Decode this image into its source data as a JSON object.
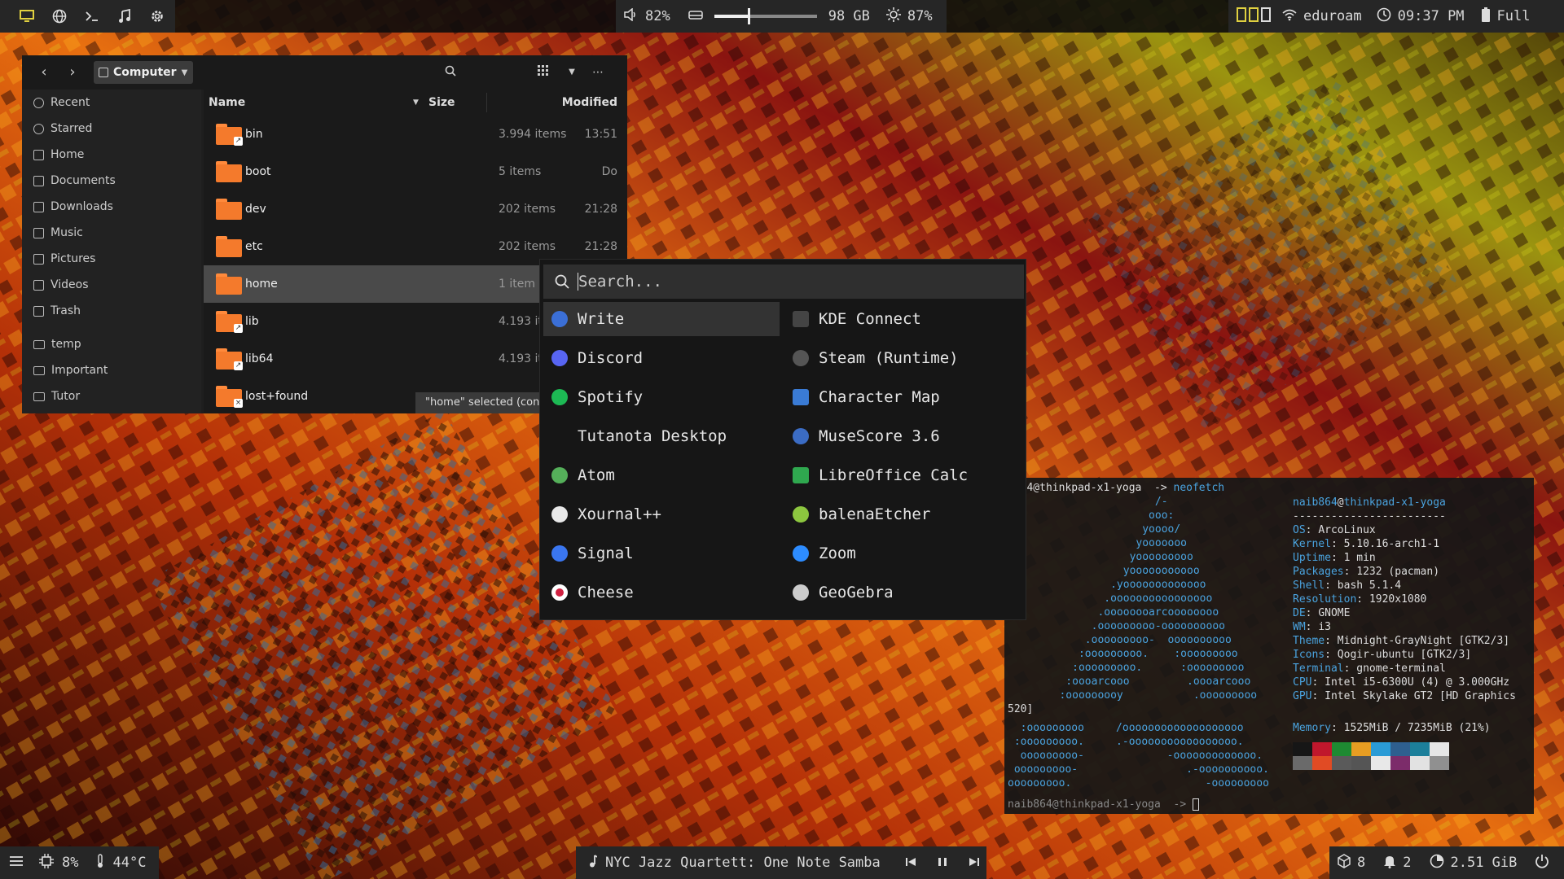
{
  "topbar": {
    "volume": "82%",
    "storage": "98 GB",
    "brightness": "87%",
    "wifi": "eduroam",
    "time": "09:37 PM",
    "battery": "Full",
    "storage_fill": 0.33
  },
  "bottombar": {
    "cpu": "8%",
    "temp": "44°C",
    "now_playing": "NYC Jazz Quartett: One Note Samba",
    "packages": "8",
    "notifications": "2",
    "memory": "2.51 GiB"
  },
  "filemanager": {
    "path": "Computer",
    "sidebar": [
      {
        "label": "Recent",
        "icon": "clock-icon"
      },
      {
        "label": "Starred",
        "icon": "star-icon"
      },
      {
        "label": "Home",
        "icon": "home-icon"
      },
      {
        "label": "Documents",
        "icon": "document-icon"
      },
      {
        "label": "Downloads",
        "icon": "download-icon"
      },
      {
        "label": "Music",
        "icon": "music-icon"
      },
      {
        "label": "Pictures",
        "icon": "picture-icon"
      },
      {
        "label": "Videos",
        "icon": "video-icon"
      },
      {
        "label": "Trash",
        "icon": "trash-icon"
      }
    ],
    "bookmarks": [
      "temp",
      "Important",
      "Tutor"
    ],
    "columns": {
      "name": "Name",
      "size": "Size",
      "modified": "Modified"
    },
    "rows": [
      {
        "name": "bin",
        "size": "3.994 items",
        "modified": "13:51"
      },
      {
        "name": "boot",
        "size": "5 items",
        "modified": "Do"
      },
      {
        "name": "dev",
        "size": "202 items",
        "modified": "21:28"
      },
      {
        "name": "etc",
        "size": "202 items",
        "modified": "21:28"
      },
      {
        "name": "home",
        "size": "1 item",
        "modified": ""
      },
      {
        "name": "lib",
        "size": "4.193 items",
        "modified": ""
      },
      {
        "name": "lib64",
        "size": "4.193 items",
        "modified": ""
      },
      {
        "name": "lost+found",
        "size": "",
        "modified": ""
      }
    ],
    "status": "\"home\" selected (con"
  },
  "launcher": {
    "placeholder": "Search...",
    "left": [
      "Write",
      "Discord",
      "Spotify",
      "Tutanota Desktop",
      "Atom",
      "Xournal++",
      "Signal",
      "Cheese"
    ],
    "right": [
      "KDE Connect",
      "Steam (Runtime)",
      "Character Map",
      "MuseScore 3.6",
      "LibreOffice Calc",
      "balenaEtcher",
      "Zoom",
      "GeoGebra"
    ],
    "icon_colors": {
      "Write": "#3b6fd6",
      "Discord": "#5865f2",
      "Spotify": "#1db954",
      "Tutanota Desktop": "transparent",
      "Atom": "#55b05a",
      "Xournal++": "#e8e8e8",
      "Signal": "#3a76f0",
      "Cheese": "#ffffff",
      "KDE Connect": "#444444",
      "Steam (Runtime)": "#555555",
      "Character Map": "#3a7bd5",
      "MuseScore 3.6": "#3b6cc4",
      "LibreOffice Calc": "#2fa84f",
      "balenaEtcher": "#8cc63f",
      "Zoom": "#2d8cff",
      "GeoGebra": "#cccccc"
    }
  },
  "terminal": {
    "user": "naib864",
    "host": "thinkpad-x1-yoga",
    "prompt_first": "b864@thinkpad-x1-yoga  -> ",
    "command": "neofetch",
    "title_user": "naib864",
    "title_host": "thinkpad-x1-yoga",
    "separator": "------------------------",
    "info": [
      {
        "k": "OS",
        "v": "ArcoLinux"
      },
      {
        "k": "Kernel",
        "v": "5.10.16-arch1-1"
      },
      {
        "k": "Uptime",
        "v": "1 min"
      },
      {
        "k": "Packages",
        "v": "1232 (pacman)"
      },
      {
        "k": "Shell",
        "v": "bash 5.1.4"
      },
      {
        "k": "Resolution",
        "v": "1920x1080"
      },
      {
        "k": "DE",
        "v": "GNOME"
      },
      {
        "k": "WM",
        "v": "i3"
      },
      {
        "k": "Theme",
        "v": "Midnight-GrayNight [GTK2/3]"
      },
      {
        "k": "Icons",
        "v": "Qogir-ubuntu [GTK2/3]"
      },
      {
        "k": "Terminal",
        "v": "gnome-terminal"
      },
      {
        "k": "CPU",
        "v": "Intel i5-6300U (4) @ 3.000GHz"
      },
      {
        "k": "GPU",
        "v": "Intel Skylake GT2 [HD Graphics"
      }
    ],
    "wrap": "520]",
    "memory_key": "Memory",
    "memory_val": "1525MiB / 7235MiB (21%)",
    "logo": [
      "                  /-",
      "                 ooo:",
      "                yoooo/",
      "               yooooooo",
      "              yooooooooo",
      "             yooooooooooo",
      "           .yooooooooooooo",
      "          .oooooooooooooooo",
      "         .oooooooarcoooooooo",
      "        .ooooooooo-oooooooooo",
      "       .ooooooooo-  oooooooooo",
      "      :ooooooooo.    :ooooooooo",
      "     :ooooooooo.      :ooooooooo",
      "    :oooarcooo         .oooarcooo",
      "   :ooooooooy           .ooooooooo"
    ],
    "logo2": [
      "  :ooooooooo     /ooooooooooooooooooo",
      " :ooooooooo.     .-ooooooooooooooooo.",
      "  ooooooooo-             -ooooooooooooo.",
      " ooooooooo-                 .-oooooooooo.",
      "ooooooooo.                     -ooooooooo"
    ],
    "prompt_last": "naib864@thinkpad-x1-yoga  -> ",
    "palette_top": [
      "#161616",
      "#c0172c",
      "#1e8a32",
      "#e79d22",
      "#2a9bd6",
      "#2e5f8f",
      "#1c7f9a",
      "#e6e6e6"
    ],
    "palette_bottom": [
      "#6a6a6a",
      "#e14b24",
      "#5a5a5a",
      "#555555",
      "#e8e8e8",
      "#7c2c6a",
      "#e2e2e2",
      "#909090"
    ]
  }
}
